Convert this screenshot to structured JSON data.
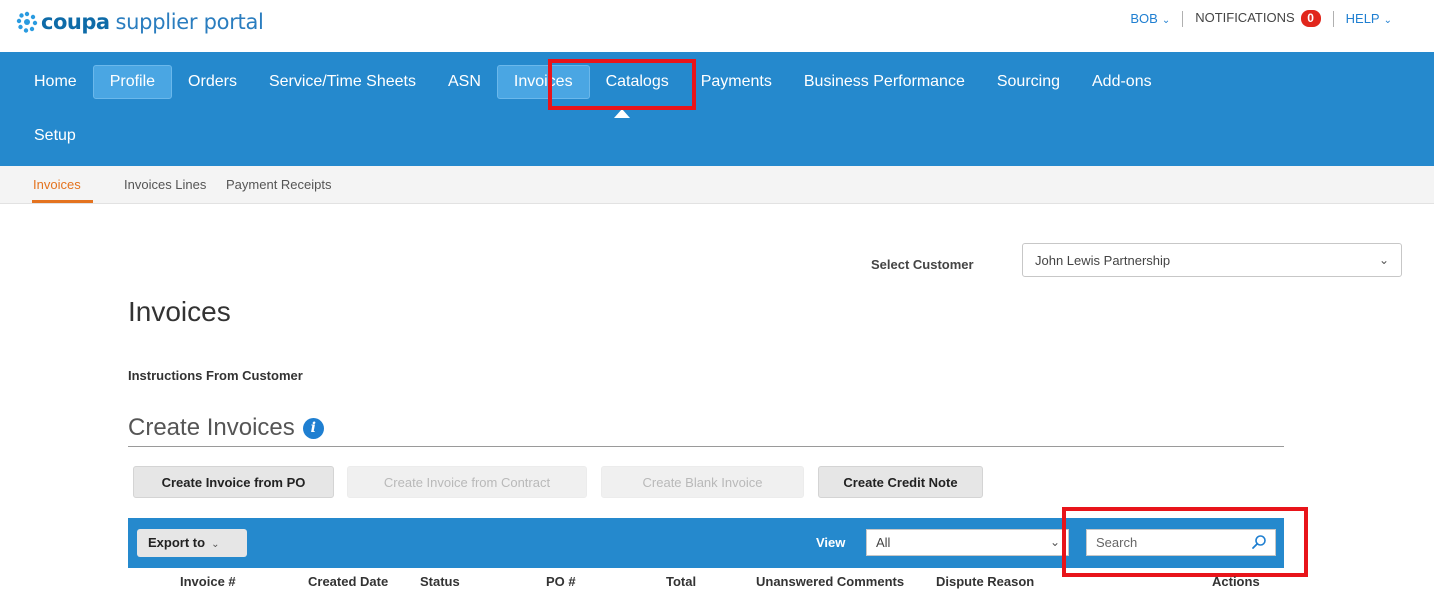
{
  "brand": {
    "name": "coupa",
    "tagline": "supplier portal",
    "colors": {
      "primary": "#2589cd",
      "highlight": "#e8141a",
      "accent": "#e4731f",
      "badge": "#e1261c"
    }
  },
  "topbar": {
    "user": "BOB",
    "notifications_label": "NOTIFICATIONS",
    "notifications_count": "0",
    "help": "HELP"
  },
  "nav": {
    "items": [
      {
        "label": "Home"
      },
      {
        "label": "Profile"
      },
      {
        "label": "Orders"
      },
      {
        "label": "Service/Time Sheets"
      },
      {
        "label": "ASN"
      },
      {
        "label": "Invoices"
      },
      {
        "label": "Catalogs"
      },
      {
        "label": "Payments"
      },
      {
        "label": "Business Performance"
      },
      {
        "label": "Sourcing"
      },
      {
        "label": "Add-ons"
      },
      {
        "label": "Setup"
      }
    ],
    "active": "Invoices"
  },
  "subnav": {
    "items": [
      {
        "label": "Invoices"
      },
      {
        "label": "Invoices Lines"
      },
      {
        "label": "Payment Receipts"
      }
    ],
    "active": "Invoices"
  },
  "customer": {
    "label": "Select Customer",
    "value": "John Lewis Partnership"
  },
  "page": {
    "title": "Invoices",
    "instructions_heading": "Instructions From Customer"
  },
  "create": {
    "heading": "Create Invoices",
    "buttons": [
      {
        "label": "Create Invoice from PO",
        "enabled": true
      },
      {
        "label": "Create Invoice from Contract",
        "enabled": false
      },
      {
        "label": "Create Blank Invoice",
        "enabled": false
      },
      {
        "label": "Create Credit Note",
        "enabled": true
      }
    ]
  },
  "table": {
    "export_label": "Export to",
    "view_label": "View",
    "view_value": "All",
    "search_placeholder": "Search",
    "columns": [
      "Invoice #",
      "Created Date",
      "Status",
      "PO #",
      "Total",
      "Unanswered Comments",
      "Dispute Reason",
      "Actions"
    ]
  }
}
